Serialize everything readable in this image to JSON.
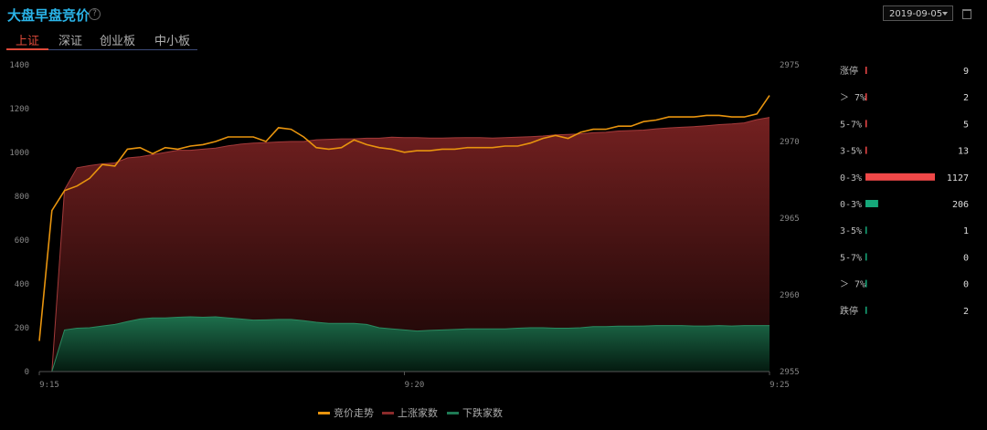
{
  "header": {
    "title": "大盘早盘竞价",
    "help_icon": "?",
    "date": "2019-09-05"
  },
  "tabs": [
    {
      "label": "上证",
      "active": true
    },
    {
      "label": "深证",
      "active": false
    },
    {
      "label": "创业板",
      "active": false
    },
    {
      "label": "中小板",
      "active": false
    }
  ],
  "colors": {
    "price": "#e8940e",
    "up": "#8b2a2a",
    "down": "#1e7a55",
    "up_bar": "#f04848",
    "down_bar": "#16a87a",
    "accent": "#2ab4e8"
  },
  "chart_data": {
    "type": "area",
    "x_ticks": [
      "9:15",
      "9:20",
      "9:25"
    ],
    "y_left": {
      "ticks": [
        0,
        200,
        400,
        600,
        800,
        1000,
        1200,
        1400
      ],
      "range": [
        0,
        1400
      ]
    },
    "y_right": {
      "ticks": [
        2955,
        2960,
        2965,
        2970,
        2975
      ],
      "range": [
        2955,
        2975
      ]
    },
    "series": [
      {
        "name": "竞价走势",
        "axis": "right",
        "kind": "line",
        "values": [
          2957.0,
          2965.5,
          2966.8,
          2967.1,
          2967.6,
          2968.5,
          2968.4,
          2969.5,
          2969.6,
          2969.2,
          2969.6,
          2969.5,
          2969.7,
          2969.8,
          2970.0,
          2970.3,
          2970.3,
          2970.3,
          2970.0,
          2970.9,
          2970.8,
          2970.3,
          2969.6,
          2969.5,
          2969.6,
          2970.1,
          2969.8,
          2969.6,
          2969.5,
          2969.3,
          2969.4,
          2969.4,
          2969.5,
          2969.5,
          2969.6,
          2969.6,
          2969.6,
          2969.7,
          2969.7,
          2969.9,
          2970.2,
          2970.4,
          2970.2,
          2970.6,
          2970.8,
          2970.8,
          2971.0,
          2971.0,
          2971.3,
          2971.4,
          2971.6,
          2971.6,
          2971.6,
          2971.7,
          2971.7,
          2971.6,
          2971.6,
          2971.8,
          2973.0
        ]
      },
      {
        "name": "上涨家数",
        "axis": "left",
        "kind": "area",
        "values": [
          0,
          0,
          830,
          930,
          940,
          948,
          952,
          975,
          980,
          990,
          1000,
          1010,
          1010,
          1015,
          1020,
          1030,
          1038,
          1043,
          1045,
          1048,
          1050,
          1050,
          1058,
          1060,
          1062,
          1062,
          1065,
          1065,
          1070,
          1068,
          1068,
          1066,
          1066,
          1067,
          1068,
          1068,
          1066,
          1068,
          1070,
          1072,
          1075,
          1080,
          1082,
          1085,
          1090,
          1092,
          1098,
          1100,
          1102,
          1108,
          1112,
          1115,
          1118,
          1122,
          1127,
          1130,
          1135,
          1150,
          1160
        ]
      },
      {
        "name": "下跌家数",
        "axis": "left",
        "kind": "area",
        "values": [
          0,
          0,
          190,
          198,
          200,
          208,
          215,
          228,
          240,
          245,
          245,
          248,
          250,
          248,
          250,
          245,
          240,
          235,
          236,
          238,
          238,
          232,
          225,
          220,
          220,
          220,
          215,
          200,
          195,
          190,
          185,
          188,
          190,
          192,
          195,
          195,
          195,
          195,
          198,
          200,
          200,
          198,
          198,
          200,
          205,
          205,
          207,
          207,
          208,
          210,
          210,
          210,
          208,
          208,
          210,
          208,
          210,
          210,
          210
        ]
      }
    ],
    "legend": {
      "placement": "bottom-center"
    },
    "grid": false
  },
  "stats": [
    {
      "label": "涨停",
      "value": "9",
      "type": "up",
      "ratio": 0.008
    },
    {
      "label": "＞ 7%",
      "value": "2",
      "type": "up",
      "ratio": 0.002
    },
    {
      "label": "5-7%",
      "value": "5",
      "type": "up",
      "ratio": 0.004
    },
    {
      "label": "3-5%",
      "value": "13",
      "type": "up",
      "ratio": 0.012
    },
    {
      "label": "0-3%",
      "value": "1127",
      "type": "up",
      "ratio": 1.0
    },
    {
      "label": "0-3%",
      "value": "206",
      "type": "down",
      "ratio": 0.183
    },
    {
      "label": "3-5%",
      "value": "1",
      "type": "down",
      "ratio": 0.001
    },
    {
      "label": "5-7%",
      "value": "0",
      "type": "down",
      "ratio": 0.0
    },
    {
      "label": "＞ 7%",
      "value": "0",
      "type": "down",
      "ratio": 0.0
    },
    {
      "label": "跌停",
      "value": "2",
      "type": "down",
      "ratio": 0.002
    }
  ]
}
